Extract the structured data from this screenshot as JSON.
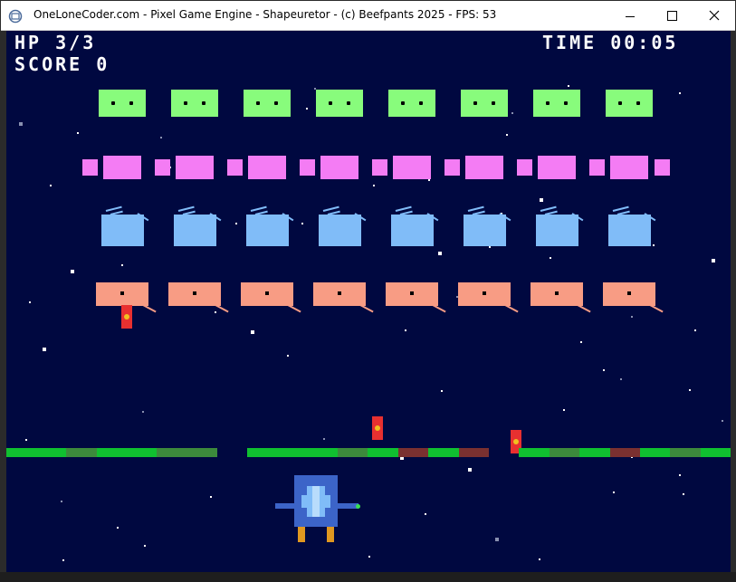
{
  "window": {
    "title": "OneLoneCoder.com - Pixel Game Engine - Shapeuretor - (c) Beefpants 2025 - FPS: 53",
    "icon": "app-icon",
    "buttons": [
      "minimize-icon",
      "maximize-icon",
      "close-icon"
    ]
  },
  "hud": {
    "hp": "HP 3/3",
    "score": "SCORE 0",
    "time": "TIME 00:05"
  },
  "colors": {
    "background": "#000840",
    "green_enemy": "#88fc7c",
    "pink_enemy": "#f47cf4",
    "blue_enemy": "#80bcf8",
    "orange_enemy": "#f89c84",
    "bullet": "#e83030",
    "bullet_core": "#f0c020",
    "shield_full": "#10c030",
    "shield_damaged": "#3c8a3c",
    "shield_critical": "#7a3030",
    "player": "#3c64c8"
  },
  "enemies": {
    "green_row_count": 8,
    "pink_row_count": 8,
    "blue_row_count": 8,
    "orange_row_count": 8
  },
  "player": {
    "hp": 3,
    "max_hp": 3
  }
}
